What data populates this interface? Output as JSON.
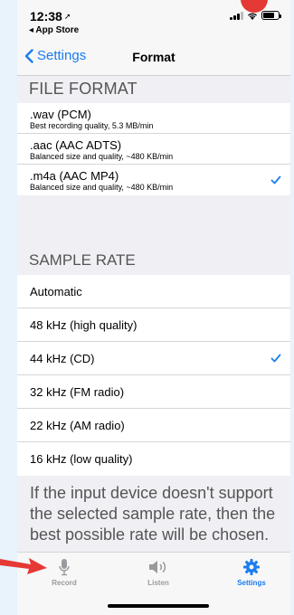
{
  "status_bar": {
    "time": "12:38",
    "back_app": "◂ App Store"
  },
  "nav": {
    "back_label": "Settings",
    "title": "Format"
  },
  "file_format": {
    "header": "FILE FORMAT",
    "items": [
      {
        "title": ".wav (PCM)",
        "subtitle": "Best recording quality, 5.3 MB/min",
        "selected": false
      },
      {
        "title": ".aac (AAC ADTS)",
        "subtitle": "Balanced size and quality, ~480 KB/min",
        "selected": false
      },
      {
        "title": ".m4a (AAC MP4)",
        "subtitle": "Balanced size and quality, ~480 KB/min",
        "selected": true
      }
    ]
  },
  "sample_rate": {
    "header": "SAMPLE RATE",
    "items": [
      {
        "label": "Automatic",
        "selected": false
      },
      {
        "label": "48 kHz (high quality)",
        "selected": false
      },
      {
        "label": "44 kHz (CD)",
        "selected": true
      },
      {
        "label": "32 kHz (FM radio)",
        "selected": false
      },
      {
        "label": "22 kHz (AM radio)",
        "selected": false
      },
      {
        "label": "16 kHz (low quality)",
        "selected": false
      }
    ]
  },
  "footer_note": "If the input device doesn't support the selected sample rate, then the best possible rate will be chosen.",
  "tabbar": {
    "record": "Record",
    "listen": "Listen",
    "settings": "Settings",
    "active": "settings"
  },
  "colors": {
    "accent": "#1a7cf0",
    "inactive_tab": "#9a9a9e",
    "annotation_red": "#e53935"
  }
}
